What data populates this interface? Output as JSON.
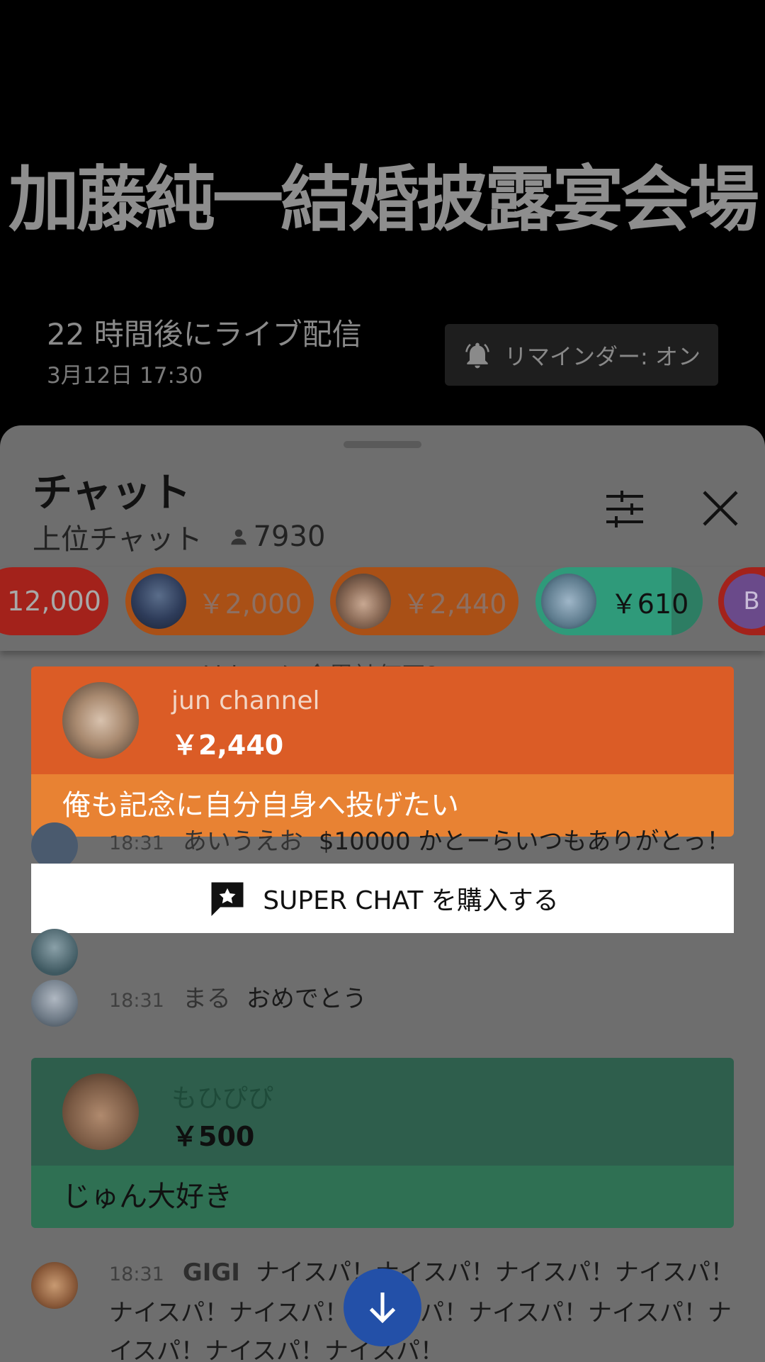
{
  "video": {
    "title": "加藤純一結婚披露宴会場",
    "countdown": "22 時間後にライブ配信",
    "date": "3月12日 17:30",
    "reminder_label": "リマインダー: オン"
  },
  "chat": {
    "title": "チャット",
    "mode": "上位チャット",
    "viewer_count": "7930",
    "ticker": [
      {
        "amount": "12,000"
      },
      {
        "amount": "￥2,000"
      },
      {
        "amount": "￥2,440"
      },
      {
        "amount": "￥610"
      },
      {
        "amount": "B"
      }
    ],
    "partial_message": "いけちゃん 今累計何円？",
    "pinned_superchat": {
      "name": "jun channel",
      "amount": "￥2,440",
      "message": "俺も記念に自分自身へ投げたい"
    },
    "behind_message": {
      "time": "18:31",
      "author": "あいうえお",
      "text": "$10000 かとーらいつもありがとっ！"
    },
    "buy_label": "SUPER CHAT を購入する",
    "messages": [
      {
        "time": "18:31",
        "author": "まる",
        "text": "おめでとう"
      }
    ],
    "superchat": {
      "name": "もひぴぴ",
      "amount": "￥500",
      "message": "じゅん大好き"
    },
    "last_message": {
      "time": "18:31",
      "author": "GIGI",
      "text": "ナイスパ！ナイスパ！ナイスパ！ナイスパ！ナイスパ！ナイスパ！ナイスパ！ナイスパ！ナイスパ！ナイスパ！ナイスパ！ナイスパ！"
    }
  },
  "colors": {
    "accent_orange": "#db5c26",
    "accent_green": "#2e5e4c",
    "scroll_button": "#2350a8"
  }
}
